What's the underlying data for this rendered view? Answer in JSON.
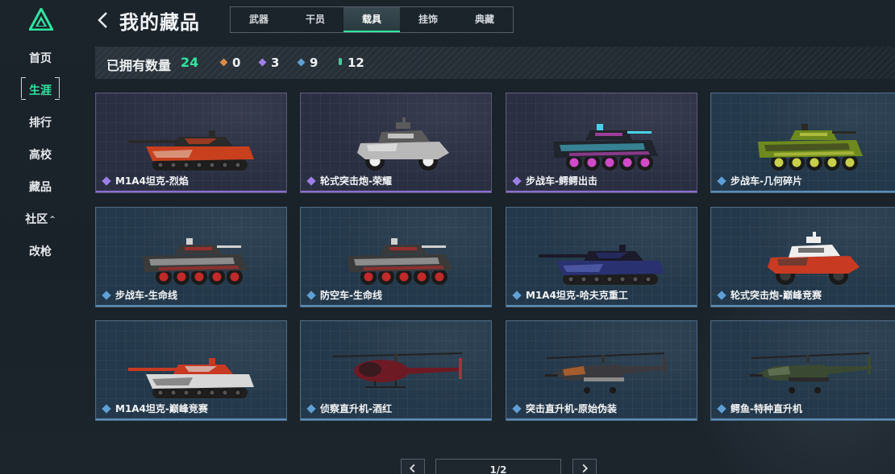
{
  "sidebar": {
    "items": [
      {
        "label": "首页",
        "active": false
      },
      {
        "label": "生涯",
        "active": true
      },
      {
        "label": "排行",
        "active": false
      },
      {
        "label": "高校",
        "active": false
      },
      {
        "label": "藏品",
        "active": false
      },
      {
        "label": "社区",
        "active": false,
        "caret": "^"
      },
      {
        "label": "改枪",
        "active": false
      }
    ]
  },
  "header": {
    "title": "我的藏品",
    "tabs": [
      {
        "label": "武器",
        "active": false
      },
      {
        "label": "干员",
        "active": false
      },
      {
        "label": "载具",
        "active": true
      },
      {
        "label": "挂饰",
        "active": false
      },
      {
        "label": "典藏",
        "active": false
      }
    ]
  },
  "stats": {
    "label": "已拥有数量",
    "total": "24",
    "rarities": [
      {
        "color": "#d88a4a",
        "count": "0"
      },
      {
        "color": "#9c80e6",
        "count": "3"
      },
      {
        "color": "#5fa0d6",
        "count": "9"
      },
      {
        "color": "#3fcf9c",
        "count": "12"
      }
    ]
  },
  "items": [
    {
      "name": "M1A4坦克-烈焰",
      "rarity": "purple",
      "kind": "tank",
      "colors": [
        "#c8401e",
        "#2a2a2a",
        "#e8e0d0"
      ]
    },
    {
      "name": "轮式突击炮-荣耀",
      "rarity": "purple",
      "kind": "buggy",
      "colors": [
        "#b9b9b9",
        "#5b5b5b",
        "#eeeeee"
      ]
    },
    {
      "name": "步战车-鳄鳄出击",
      "rarity": "purple",
      "kind": "apc",
      "colors": [
        "#20242c",
        "#4ad0e8",
        "#d04ac8"
      ]
    },
    {
      "name": "步战车-几何碎片",
      "rarity": "blue",
      "kind": "apc",
      "colors": [
        "#6e8a1e",
        "#2a2a22",
        "#c8d04a"
      ]
    },
    {
      "name": "步战车-生命线",
      "rarity": "blue",
      "kind": "apc",
      "colors": [
        "#3a3a3a",
        "#d0d0d0",
        "#c02a2a"
      ]
    },
    {
      "name": "防空车-生命线",
      "rarity": "blue",
      "kind": "apc",
      "colors": [
        "#3a3a3a",
        "#d0d0d0",
        "#c02a2a"
      ]
    },
    {
      "name": "M1A4坦克-哈夫克重工",
      "rarity": "blue",
      "kind": "tank",
      "colors": [
        "#2a3170",
        "#1a1a2a",
        "#6a7ad0"
      ]
    },
    {
      "name": "轮式突击炮-巅峰竞赛",
      "rarity": "blue",
      "kind": "buggy",
      "colors": [
        "#c83a22",
        "#eeeeee",
        "#3a3a3a"
      ]
    },
    {
      "name": "M1A4坦克-巅峰竞赛",
      "rarity": "blue",
      "kind": "tank",
      "colors": [
        "#d8d8d8",
        "#c83a22",
        "#3a3a3a"
      ]
    },
    {
      "name": "侦察直升机-酒红",
      "rarity": "blue",
      "kind": "heli-small",
      "colors": [
        "#6e1a24",
        "#2a1a1e",
        "#a83040"
      ]
    },
    {
      "name": "突击直升机-原始伪装",
      "rarity": "blue",
      "kind": "heli-attack",
      "colors": [
        "#3a3a3e",
        "#c86a2a",
        "#8a8a8a"
      ]
    },
    {
      "name": "鳄鱼-特种直升机",
      "rarity": "blue",
      "kind": "heli-attack",
      "colors": [
        "#3a4a32",
        "#6a7a5a",
        "#2a2a2a"
      ]
    }
  ],
  "pagination": {
    "page": "1/2"
  }
}
